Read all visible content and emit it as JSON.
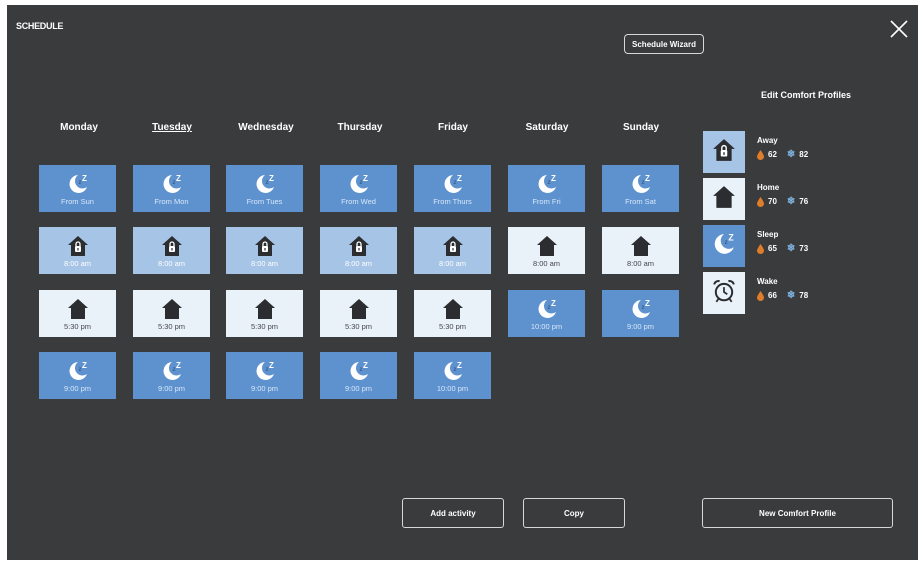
{
  "header": {
    "title": "SCHEDULE",
    "wizard_label": "Schedule Wizard"
  },
  "days": [
    "Monday",
    "Tuesday",
    "Wednesday",
    "Thursday",
    "Friday",
    "Saturday",
    "Sunday"
  ],
  "active_day": "Tuesday",
  "schedule": {
    "monday": [
      {
        "profile": "sleep",
        "label": "From Sun"
      },
      {
        "profile": "away",
        "label": "8:00 am"
      },
      {
        "profile": "home",
        "label": "5:30 pm"
      },
      {
        "profile": "sleep",
        "label": "9:00 pm"
      }
    ],
    "tuesday": [
      {
        "profile": "sleep",
        "label": "From Mon"
      },
      {
        "profile": "away",
        "label": "8:00 am"
      },
      {
        "profile": "home",
        "label": "5:30 pm"
      },
      {
        "profile": "sleep",
        "label": "9:00 pm"
      }
    ],
    "wednesday": [
      {
        "profile": "sleep",
        "label": "From Tues"
      },
      {
        "profile": "away",
        "label": "8:00 am"
      },
      {
        "profile": "home",
        "label": "5:30 pm"
      },
      {
        "profile": "sleep",
        "label": "9:00 pm"
      }
    ],
    "thursday": [
      {
        "profile": "sleep",
        "label": "From Wed"
      },
      {
        "profile": "away",
        "label": "8:00 am"
      },
      {
        "profile": "home",
        "label": "5:30 pm"
      },
      {
        "profile": "sleep",
        "label": "9:00 pm"
      }
    ],
    "friday": [
      {
        "profile": "sleep",
        "label": "From Thurs"
      },
      {
        "profile": "away",
        "label": "8:00 am"
      },
      {
        "profile": "home",
        "label": "5:30 pm"
      },
      {
        "profile": "sleep",
        "label": "10:00 pm"
      }
    ],
    "saturday": [
      {
        "profile": "sleep",
        "label": "From Fri"
      },
      {
        "profile": "home",
        "label": "8:00 am"
      },
      {
        "profile": "sleep",
        "label": "10:00 pm"
      }
    ],
    "sunday": [
      {
        "profile": "sleep",
        "label": "From Sat"
      },
      {
        "profile": "home",
        "label": "8:00 am"
      },
      {
        "profile": "sleep",
        "label": "9:00 pm"
      }
    ]
  },
  "comfort_profiles": {
    "title": "Edit Comfort Profiles",
    "items": [
      {
        "name": "Away",
        "icon": "lock-house-icon",
        "heat": "62",
        "cool": "82"
      },
      {
        "name": "Home",
        "icon": "house-icon",
        "heat": "70",
        "cool": "76"
      },
      {
        "name": "Sleep",
        "icon": "moon-zz-icon",
        "heat": "65",
        "cool": "73"
      },
      {
        "name": "Wake",
        "icon": "alarm-clock-icon",
        "heat": "66",
        "cool": "78"
      }
    ]
  },
  "actions": {
    "add_activity": "Add activity",
    "copy": "Copy",
    "new_profile": "New Comfort Profile"
  },
  "colors": {
    "panel_bg": "#3a3b3c",
    "sleep_tile": "#5e92cf",
    "away_tile": "#a6c4e6",
    "home_tile": "#e9f1f9",
    "heat_drop": "#e07d2b",
    "cool_flake": "#7fb3e0"
  }
}
